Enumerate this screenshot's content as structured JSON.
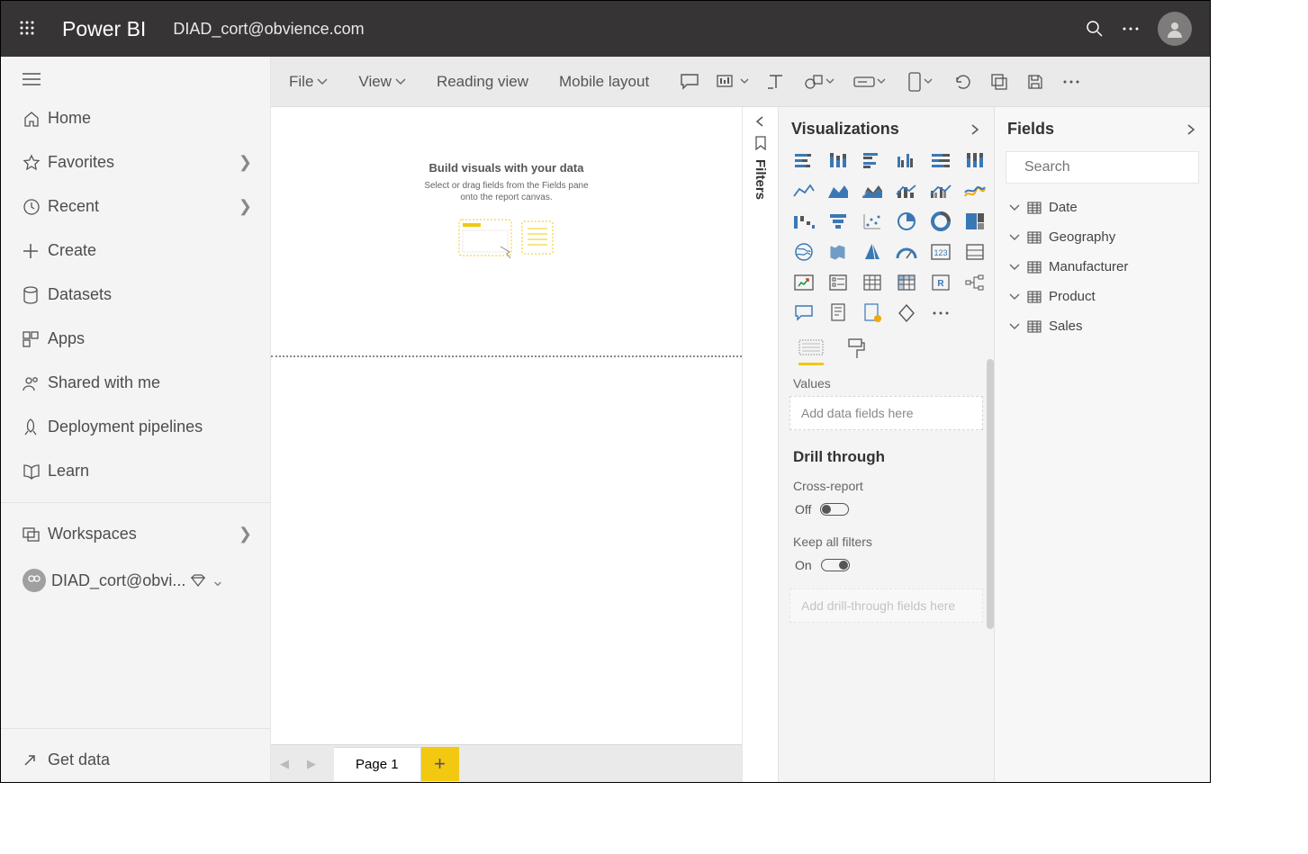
{
  "topbar": {
    "brand": "Power BI",
    "user_email": "DIAD_cort@obvience.com"
  },
  "leftnav": {
    "items": [
      {
        "label": "Home",
        "icon": "home"
      },
      {
        "label": "Favorites",
        "icon": "star",
        "chevron": true
      },
      {
        "label": "Recent",
        "icon": "clock",
        "chevron": true
      },
      {
        "label": "Create",
        "icon": "plus"
      },
      {
        "label": "Datasets",
        "icon": "cylinder"
      },
      {
        "label": "Apps",
        "icon": "apps"
      },
      {
        "label": "Shared with me",
        "icon": "people"
      },
      {
        "label": "Deployment pipelines",
        "icon": "rocket"
      },
      {
        "label": "Learn",
        "icon": "book"
      }
    ],
    "workspaces_label": "Workspaces",
    "current_ws": "DIAD_cort@obvi...",
    "get_data": "Get data"
  },
  "ribbon": {
    "file": "File",
    "view": "View",
    "reading_view": "Reading view",
    "mobile_layout": "Mobile layout"
  },
  "canvas": {
    "title": "Build visuals with your data",
    "sub1": "Select or drag fields from the Fields pane",
    "sub2": "onto the report canvas."
  },
  "filters_label": "Filters",
  "viz": {
    "title": "Visualizations",
    "values_label": "Values",
    "values_placeholder": "Add data fields here",
    "drill_title": "Drill through",
    "cross_report_label": "Cross-report",
    "cross_report_state": "Off",
    "keep_filters_label": "Keep all filters",
    "keep_filters_state": "On",
    "drill_placeholder": "Add drill-through fields here"
  },
  "fields": {
    "title": "Fields",
    "search_placeholder": "Search",
    "tables": [
      "Date",
      "Geography",
      "Manufacturer",
      "Product",
      "Sales"
    ]
  },
  "pager": {
    "tabs": [
      "Page 1"
    ]
  }
}
